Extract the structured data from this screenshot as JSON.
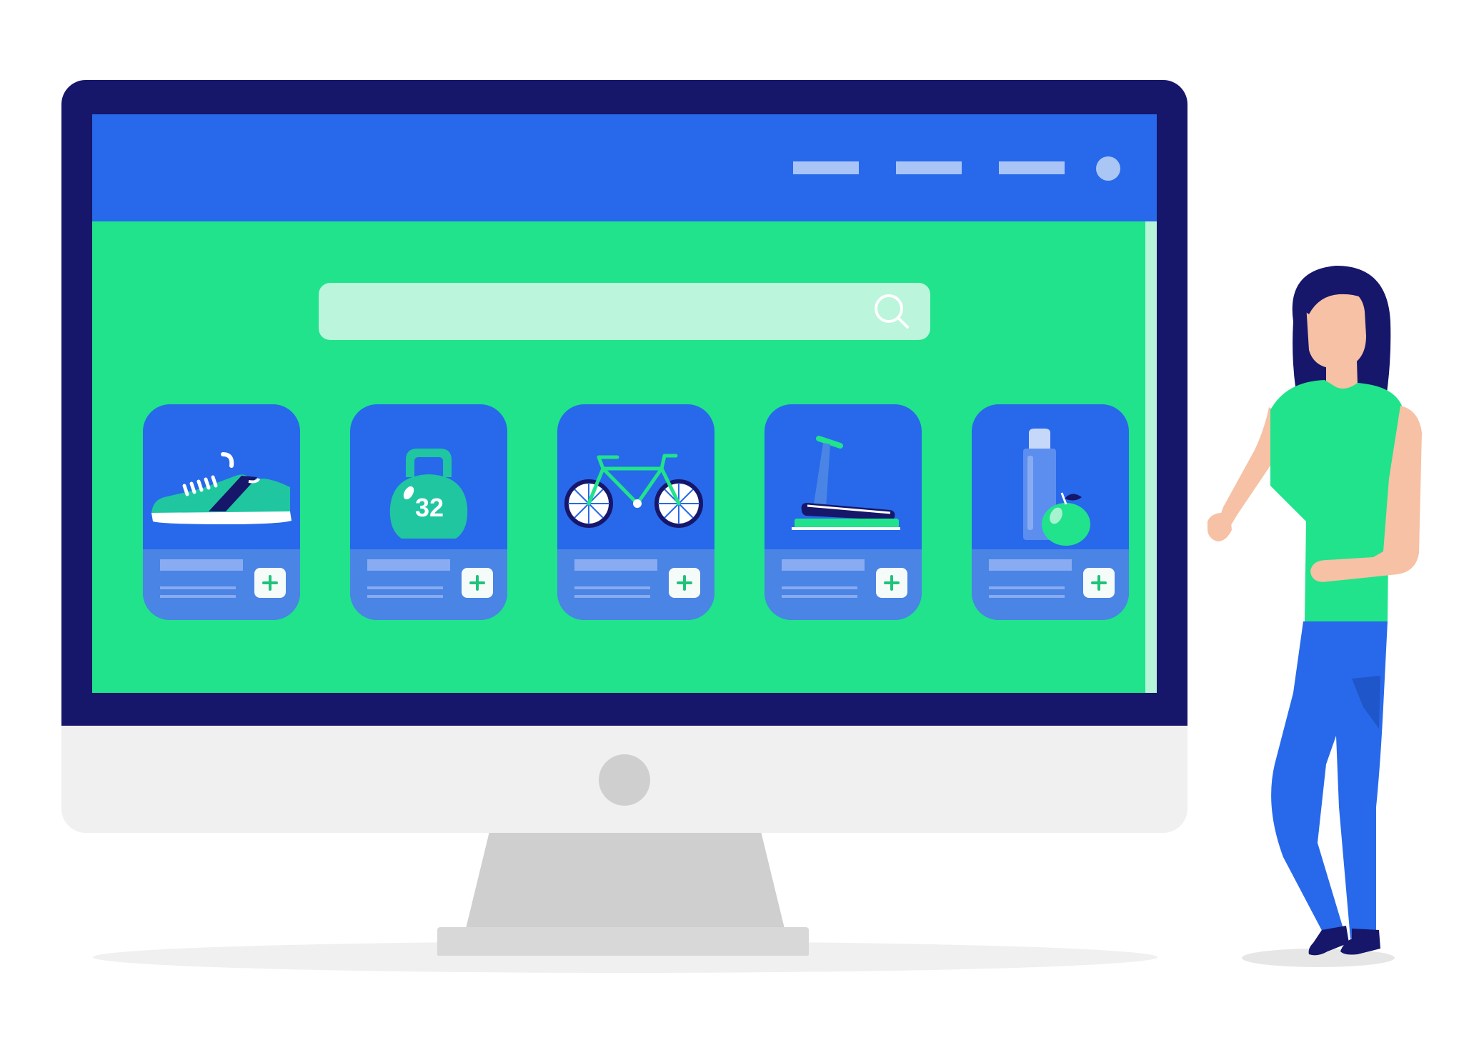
{
  "colors": {
    "header": "#2769ea",
    "screen_bg": "#20e38b",
    "bezel": "#16166b",
    "card": "#2769ea",
    "card_footer": "#4a84e5",
    "search_bar": "#baf5dc",
    "add_icon": "#20c27a"
  },
  "header": {
    "nav_links": 3,
    "has_avatar": true
  },
  "search": {
    "icon": "search-icon"
  },
  "products": [
    {
      "icon": "sneaker-icon"
    },
    {
      "icon": "kettlebell-icon",
      "label": "32"
    },
    {
      "icon": "bicycle-icon"
    },
    {
      "icon": "treadmill-icon"
    },
    {
      "icon": "water-bottle-apple-icon"
    }
  ],
  "card_action_icon": "plus-icon"
}
